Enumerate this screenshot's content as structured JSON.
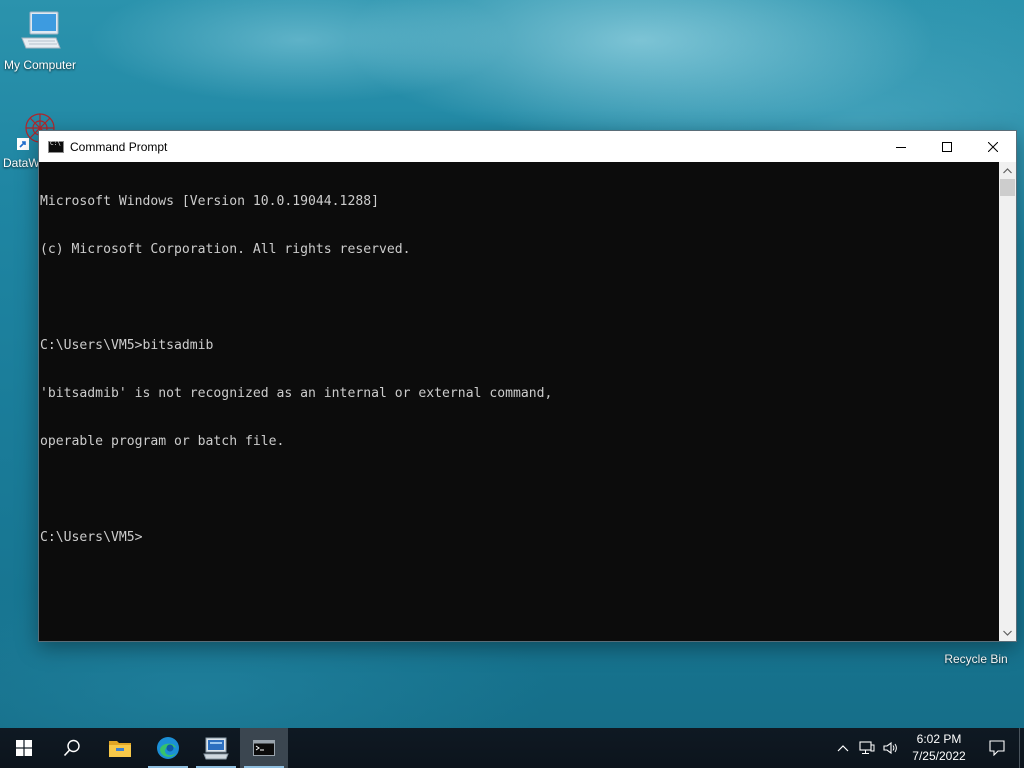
{
  "desktop": {
    "icons": [
      {
        "label": "My Computer",
        "icon": "computer-icon"
      },
      {
        "label": "DataW",
        "icon": "datawrapper-shortcut-icon"
      },
      {
        "label": "Recycle Bin",
        "icon": "recycle-bin-icon"
      }
    ]
  },
  "window": {
    "title": "Command Prompt",
    "icon": "console-icon",
    "controls": {
      "minimize": "minimize-icon",
      "maximize": "maximize-icon",
      "close": "close-icon"
    },
    "lines": [
      "Microsoft Windows [Version 10.0.19044.1288]",
      "(c) Microsoft Corporation. All rights reserved.",
      "",
      "C:\\Users\\VM5>bitsadmib",
      "'bitsadmib' is not recognized as an internal or external command,",
      "operable program or batch file.",
      "",
      "C:\\Users\\VM5>"
    ],
    "colors": {
      "background": "#0c0c0c",
      "text": "#cccccc"
    }
  },
  "taskbar": {
    "buttons": [
      {
        "name": "start-button",
        "icon": "windows-logo-icon"
      },
      {
        "name": "search-button",
        "icon": "search-icon"
      },
      {
        "name": "file-explorer-button",
        "icon": "folder-icon"
      },
      {
        "name": "edge-button",
        "icon": "edge-icon"
      },
      {
        "name": "remote-desktop-button",
        "icon": "computer-app-icon"
      },
      {
        "name": "command-prompt-button",
        "icon": "console-icon",
        "active": true
      }
    ],
    "tray": {
      "icons": [
        "chevron-up-icon",
        "network-icon",
        "volume-icon"
      ],
      "time": "6:02 PM",
      "date": "7/25/2022",
      "notification_icon": "notification-icon"
    }
  }
}
